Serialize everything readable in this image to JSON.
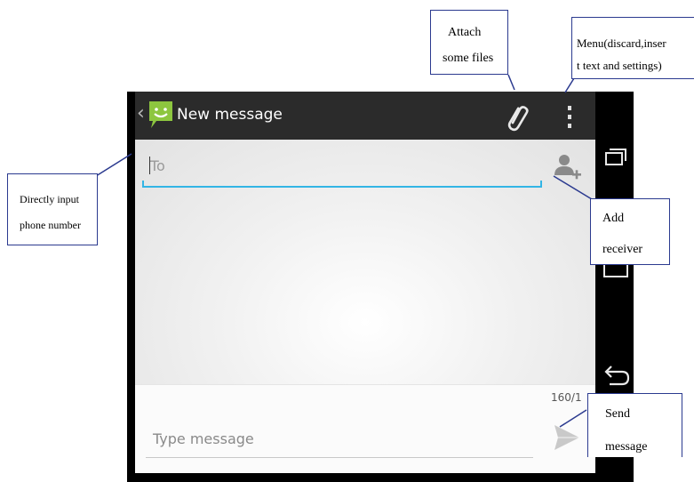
{
  "actionbar": {
    "back_glyph": "‹",
    "title": "New message"
  },
  "to_field": {
    "placeholder": "To"
  },
  "compose": {
    "char_counter": "160/1",
    "placeholder": "Type message"
  },
  "callouts": {
    "attach": {
      "line1": "Attach",
      "line2": "some files"
    },
    "menu": {
      "line1": "Menu(discard,inser",
      "line2": "t text and settings)"
    },
    "direct_input": {
      "line1": "Directly input",
      "line2": "phone number"
    },
    "add_receiver": {
      "line1": "Add",
      "line2": "receiver"
    },
    "send": {
      "line1": "Send",
      "line2": "message"
    }
  },
  "colors": {
    "accent_line": "#33b5e5",
    "app_icon": "#8dc63f",
    "callout_border": "#2b3a8f"
  },
  "icons": [
    "messaging-app-icon",
    "paperclip-icon",
    "overflow-menu-icon",
    "add-contact-icon",
    "send-icon",
    "recent-apps-icon",
    "home-icon",
    "back-icon"
  ]
}
